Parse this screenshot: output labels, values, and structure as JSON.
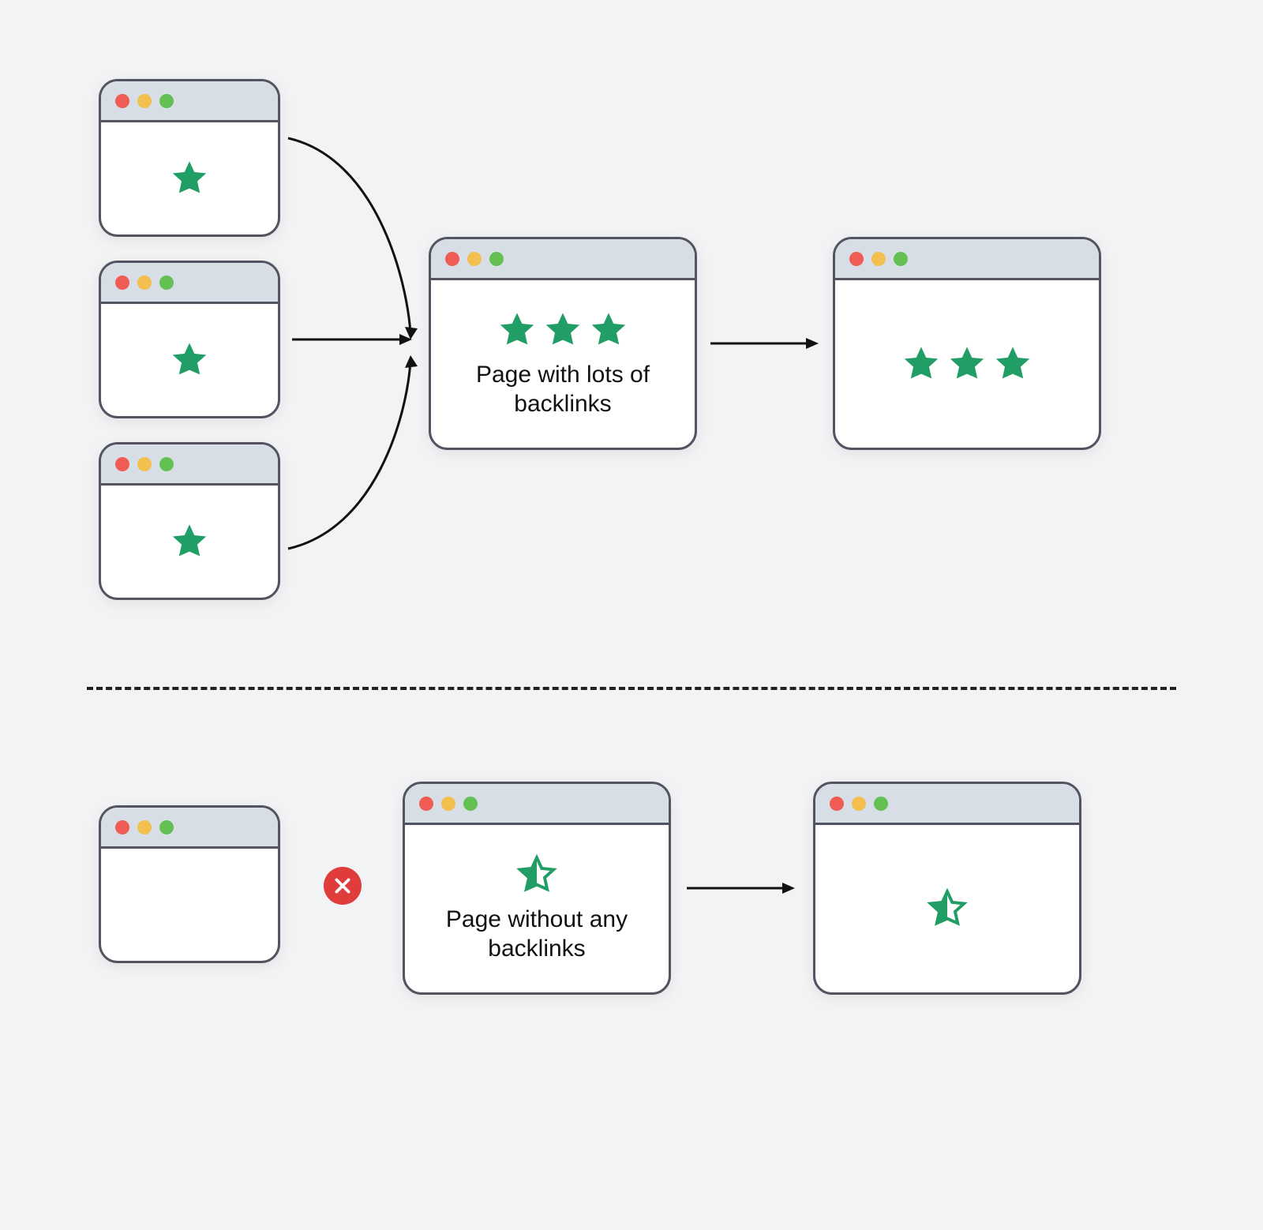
{
  "colors": {
    "star": "#219e66",
    "x_badge": "#e13c3c",
    "dot_red": "#ee5c54",
    "dot_yellow": "#f3bf4f",
    "dot_green": "#63c154",
    "window_border": "#535361",
    "titlebar": "#d7dee6"
  },
  "icons": {
    "star": "star-icon",
    "half_star": "half-star-icon",
    "x": "x-circle-icon",
    "arrow": "arrow-right-icon"
  },
  "top": {
    "sources": [
      {
        "stars": 1
      },
      {
        "stars": 1
      },
      {
        "stars": 1
      }
    ],
    "center": {
      "stars": 3,
      "caption": "Page with lots of backlinks"
    },
    "result": {
      "stars": 3
    }
  },
  "bottom": {
    "source": {
      "stars": 0
    },
    "blocked": true,
    "center": {
      "half_star": true,
      "caption": "Page without any backlinks"
    },
    "result": {
      "half_star": true
    }
  }
}
